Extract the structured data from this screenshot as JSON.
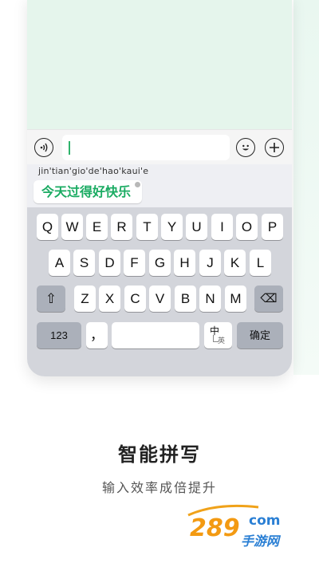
{
  "input_bar": {
    "voice_icon": "voice-input-icon",
    "emoji_icon": "emoji-icon",
    "plus_icon": "plus-icon",
    "text_value": ""
  },
  "ime": {
    "pinyin": "jin'tian'gio'de'hao'kaui'e",
    "candidate": "今天过得好快乐"
  },
  "keyboard": {
    "row1": [
      "Q",
      "W",
      "E",
      "R",
      "T",
      "Y",
      "U",
      "I",
      "O",
      "P"
    ],
    "row2": [
      "A",
      "S",
      "D",
      "F",
      "G",
      "H",
      "J",
      "K",
      "L"
    ],
    "row3": [
      "Z",
      "X",
      "C",
      "V",
      "B",
      "N",
      "M"
    ],
    "shift_label": "⇧",
    "delete_label": "⌫",
    "numbers_label": "123",
    "punct_label": "，",
    "space_label": "",
    "lang_main": "中",
    "lang_sub": "英",
    "confirm_label": "确定"
  },
  "promo": {
    "title": "智能拼写",
    "subtitle": "输入效率成倍提升"
  },
  "watermark": {
    "number": "289",
    "domain": "com",
    "text": "手游网"
  },
  "colors": {
    "accent": "#1aab62",
    "chat_bg": "#e5f5ec",
    "keyboard_bg": "#d3d5db"
  }
}
